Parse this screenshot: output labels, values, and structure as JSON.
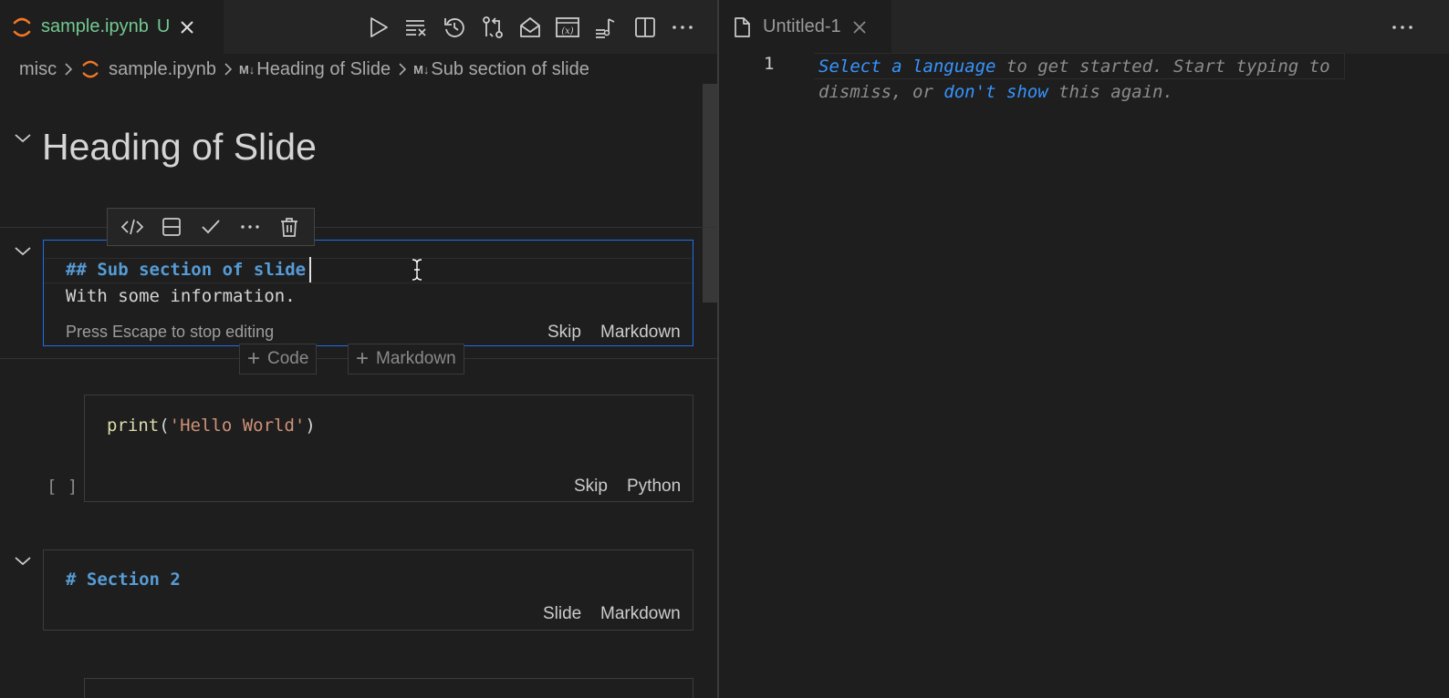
{
  "colors": {
    "background": "#1e1e1e",
    "tab_bar": "#252526",
    "focus_border": "#1f6feb",
    "untracked_green": "#73c991",
    "markdown_heading_blue": "#569cd6",
    "link_blue": "#3794ff",
    "string_orange": "#ce9178",
    "function_yellow": "#dcdcaa",
    "jupyter_orange": "#f37726"
  },
  "left_editor": {
    "tab": {
      "icon": "jupyter-icon",
      "label": "sample.ipynb",
      "status": "U",
      "close_icon": "close-icon"
    },
    "toolbar_icons": [
      "run-all-icon",
      "clear-outputs-icon",
      "restart-icon",
      "source-control-compare-icon",
      "open-in-interactive-icon",
      "variables-icon",
      "outline-icon",
      "split-editor-icon",
      "more-actions-icon"
    ],
    "breadcrumb": {
      "root": "misc",
      "file": "sample.ipynb",
      "markdown_badge": "M↓",
      "items": [
        "Heading of Slide",
        "Sub section of slide"
      ]
    },
    "notebook": {
      "heading": "Heading of Slide",
      "cell_toolbar_icons": [
        "code-icon",
        "split-cell-icon",
        "check-icon",
        "more-icon",
        "trash-icon"
      ],
      "active_markdown_cell": {
        "line1": "## Sub section of slide",
        "line2": "With some information.",
        "hint": "Press Escape to stop editing",
        "slide_type": "Skip",
        "language": "Markdown"
      },
      "add_cell": {
        "code_label": "Code",
        "markdown_label": "Markdown"
      },
      "code_cell": {
        "func": "print",
        "open": "(",
        "string": "'Hello World'",
        "close": ")",
        "execution_count": "[ ]",
        "slide_type": "Skip",
        "language": "Python"
      },
      "section2_cell": {
        "line1": "# Section 2",
        "slide_type": "Slide",
        "language": "Markdown"
      }
    }
  },
  "right_editor": {
    "tab": {
      "icon": "file-icon",
      "label": "Untitled-1",
      "close_icon": "close-icon"
    },
    "more_icon": "more-actions-icon",
    "line_number": "1",
    "hint": {
      "link1": "Select a language",
      "text1": " to get started. Start typing to dismiss, or ",
      "link2": "don't show",
      "text2": " this again."
    }
  }
}
